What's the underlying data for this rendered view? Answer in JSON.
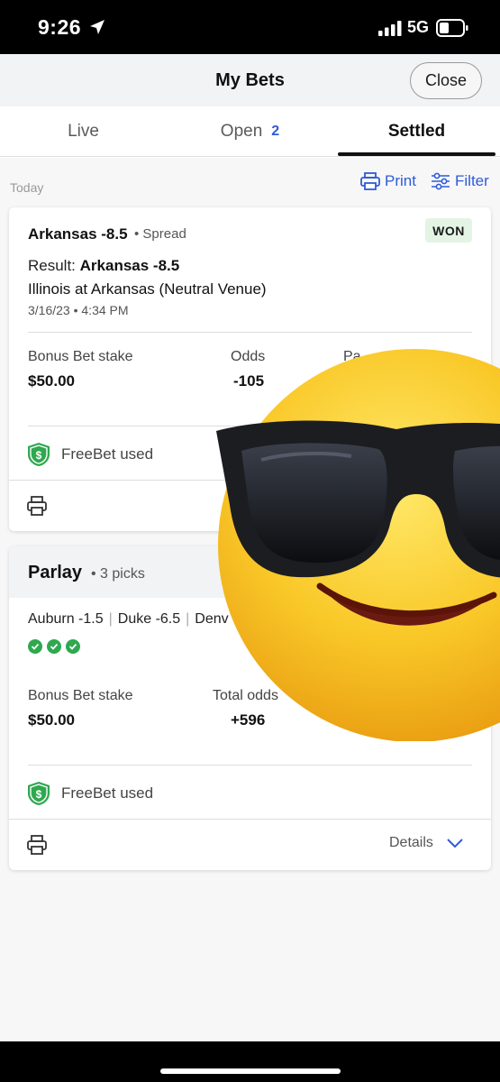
{
  "status_bar": {
    "time": "9:26",
    "network": "5G"
  },
  "header": {
    "title": "My Bets",
    "close_label": "Close"
  },
  "tabs": [
    {
      "label": "Live"
    },
    {
      "label": "Open",
      "badge": "2"
    },
    {
      "label": "Settled",
      "active": true
    }
  ],
  "toolbar": {
    "section_label": "Today",
    "print_label": "Print",
    "filter_label": "Filter"
  },
  "bet1": {
    "title": "Arkansas -8.5",
    "type": "• Spread",
    "status": "WON",
    "result_prefix": "Result:",
    "result_value": "Arkansas -8.5",
    "matchup": "Illinois at Arkansas (Neutral Venue)",
    "datetime": "3/16/23 • 4:34 PM",
    "stake_label": "Bonus Bet stake",
    "stake_value": "$50.00",
    "odds_label": "Odds",
    "odds_value": "-105",
    "payout_label_partial": "Pa",
    "freebet_label": "FreeBet used"
  },
  "bet2": {
    "title": "Parlay",
    "picks": "• 3 picks",
    "legs": [
      "Auburn -1.5",
      "Duke -6.5",
      "Denv"
    ],
    "stake_label": "Bonus Bet stake",
    "stake_value": "$50.00",
    "odds_label": "Total odds",
    "odds_value": "+596",
    "freebet_label": "FreeBet used",
    "details_label": "Details"
  },
  "colors": {
    "accent": "#2f5bd6",
    "won_badge_bg": "#e3f4e5",
    "success": "#2fa84f",
    "header_bg": "#f2f3f5"
  },
  "icons": [
    "location-arrow-icon",
    "signal-icon",
    "battery-icon",
    "printer-icon",
    "filter-icon",
    "shield-dollar-icon",
    "check-circle-icon",
    "chevron-down-icon",
    "sunglasses-emoji"
  ]
}
